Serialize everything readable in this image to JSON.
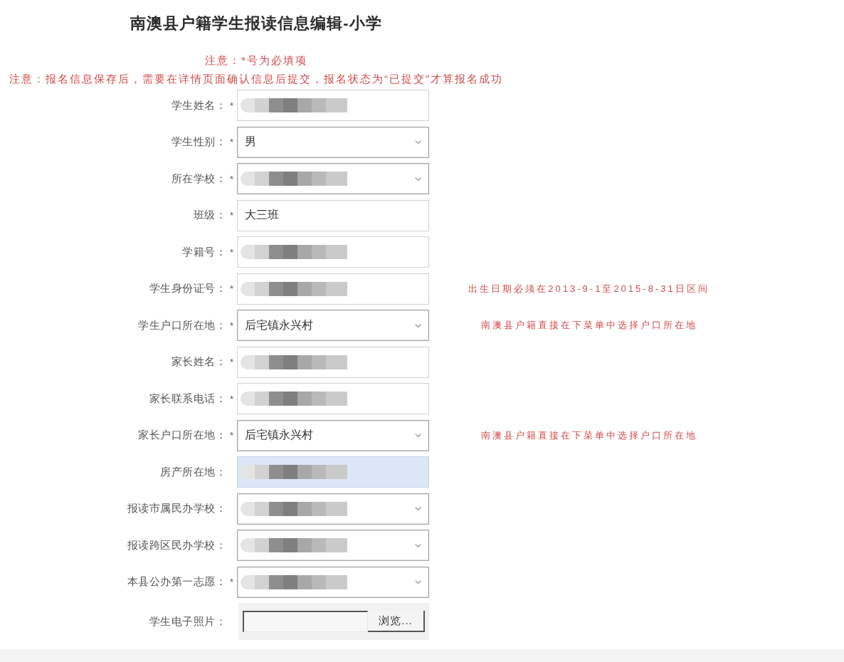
{
  "page": {
    "title": "南澳县户籍学生报读信息编辑-小学",
    "notices": [
      "注意：*号为必填项",
      "注意：报名信息保存后，需要在详情页面确认信息后提交，报名状态为“已提交”才算报名成功"
    ]
  },
  "form": {
    "required_mark": "*",
    "fields": [
      {
        "kind": "text",
        "label": "学生姓名：",
        "required": true,
        "redacted": true,
        "autofill": false
      },
      {
        "kind": "select",
        "label": "学生性别：",
        "required": true,
        "value": "男",
        "redacted": false,
        "autofill": false
      },
      {
        "kind": "select",
        "label": "所在学校：",
        "required": true,
        "redacted": true,
        "autofill": false
      },
      {
        "kind": "text",
        "label": "班级：",
        "required": true,
        "value": "大三班",
        "redacted": false,
        "autofill": false
      },
      {
        "kind": "text",
        "label": "学籍号：",
        "required": true,
        "redacted": true,
        "autofill": false
      },
      {
        "kind": "text",
        "label": "学生身份证号：",
        "required": true,
        "redacted": true,
        "autofill": false,
        "hint": "出生日期必须在2013-9-1至2015-8-31日区间"
      },
      {
        "kind": "select",
        "label": "学生户口所在地：",
        "required": true,
        "value": "后宅镇永兴村",
        "redacted": false,
        "autofill": false,
        "hint": "南澳县户籍直接在下菜单中选择户口所在地"
      },
      {
        "kind": "text",
        "label": "家长姓名：",
        "required": true,
        "redacted": true,
        "autofill": false
      },
      {
        "kind": "text",
        "label": "家长联系电话：",
        "required": true,
        "redacted": true,
        "autofill": false
      },
      {
        "kind": "select",
        "label": "家长户口所在地：",
        "required": true,
        "value": "后宅镇永兴村",
        "redacted": false,
        "autofill": false,
        "hint": "南澳县户籍直接在下菜单中选择户口所在地"
      },
      {
        "kind": "text",
        "label": "房产所在地：",
        "required": false,
        "redacted": true,
        "autofill": true
      },
      {
        "kind": "select",
        "label": "报读市属民办学校：",
        "required": false,
        "redacted": true,
        "autofill": false
      },
      {
        "kind": "select",
        "label": "报读跨区民办学校：",
        "required": false,
        "redacted": true,
        "autofill": false
      },
      {
        "kind": "select",
        "label": "本县公办第一志愿：",
        "required": true,
        "redacted": true,
        "autofill": false
      },
      {
        "kind": "file",
        "label": "学生电子照片：",
        "required": false,
        "button": "浏览...",
        "redacted": false,
        "autofill": false
      }
    ]
  }
}
